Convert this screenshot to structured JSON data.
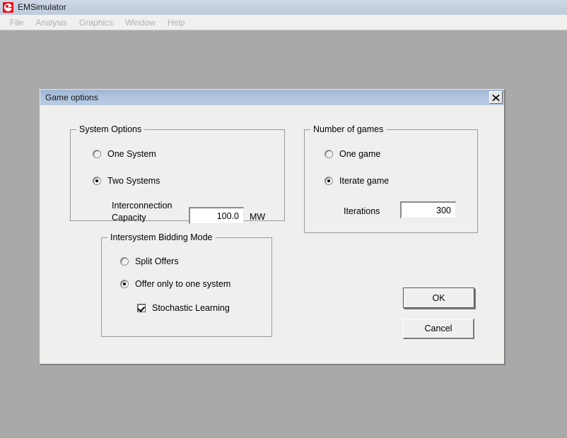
{
  "app": {
    "title": "EMSimulator",
    "icon": "app-logo-icon",
    "menu": [
      "File",
      "Analysis",
      "Graphics",
      "Window",
      "Help"
    ]
  },
  "dialog": {
    "title": "Game options",
    "close_icon": "close-icon",
    "system_options": {
      "legend": "System Options",
      "radios": [
        {
          "label": "One System",
          "selected": false
        },
        {
          "label": "Two Systems",
          "selected": true
        }
      ],
      "interconnection": {
        "label_line1": "Interconnection",
        "label_line2": "Capacity",
        "value": "100.0",
        "unit": "MW"
      }
    },
    "bidding_mode": {
      "legend": "Intersystem Bidding Mode",
      "radios": [
        {
          "label": "Split Offers",
          "selected": false
        },
        {
          "label": "Offer only to one system",
          "selected": true
        }
      ],
      "checkbox": {
        "label": "Stochastic Learning",
        "checked": true
      }
    },
    "number_of_games": {
      "legend": "Number of games",
      "radios": [
        {
          "label": "One game",
          "selected": false
        },
        {
          "label": "Iterate game",
          "selected": true
        }
      ],
      "iterations": {
        "label": "Iterations",
        "value": "300"
      }
    },
    "buttons": {
      "ok": "OK",
      "cancel": "Cancel"
    }
  },
  "colors": {
    "desktop": "#a9a9a9",
    "dialog_face": "#efefed",
    "dialog_titlebar": "#aec3de",
    "app_titlebar": "#c3cfdf",
    "app_icon": "#e8131a",
    "menu_text_disabled": "#b0b0b0"
  }
}
